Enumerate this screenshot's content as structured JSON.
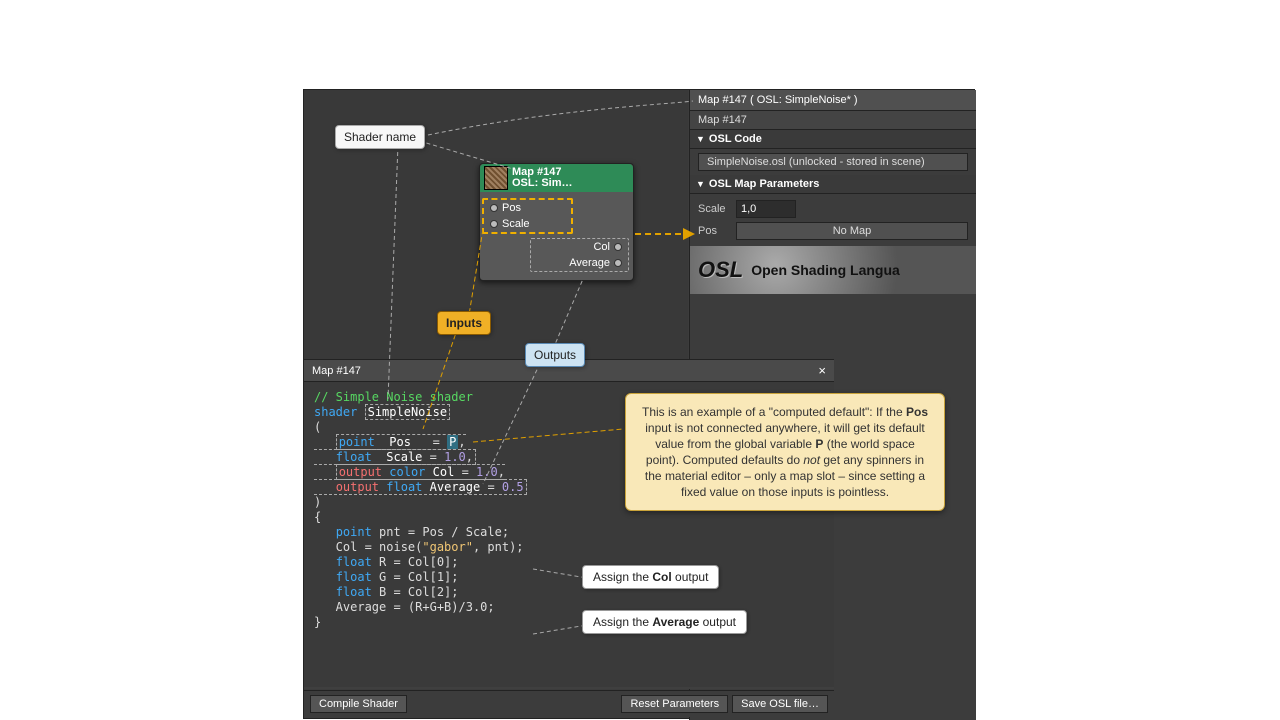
{
  "callouts": {
    "shader_name": "Shader name",
    "inputs": "Inputs",
    "outputs": "Outputs",
    "assign_col_pre": "Assign the ",
    "assign_col_bold": "Col",
    "assign_col_post": " output",
    "assign_avg_pre": "Assign the ",
    "assign_avg_bold": "Average",
    "assign_avg_post": " output"
  },
  "node": {
    "title_line1": "Map #147",
    "title_line2": "OSL: Sim…",
    "inputs": [
      "Pos",
      "Scale"
    ],
    "outputs": [
      "Col",
      "Average"
    ]
  },
  "side": {
    "title": "Map #147 ( OSL: SimpleNoise* )",
    "subtitle": "Map #147",
    "rollout_code_hdr": "OSL Code",
    "osl_file_field": "SimpleNoise.osl (unlocked - stored in scene)",
    "rollout_params_hdr": "OSL Map Parameters",
    "params": {
      "scale_label": "Scale",
      "scale_value": "1,0",
      "pos_label": "Pos",
      "pos_map_btn": "No Map"
    },
    "logo_mark": "OSL",
    "logo_text": "Open Shading Langua"
  },
  "editor": {
    "title": "Map #147",
    "close": "×",
    "comment": "// Simple Noise shader",
    "kw_shader": "shader",
    "shader_name": "SimpleNoise",
    "decl": {
      "t_point": "point",
      "id_pos": "Pos",
      "eq": "=",
      "p_hl": "P",
      "t_float": "float",
      "id_scale": "Scale",
      "val_scale": "1.0",
      "kw_output": "output",
      "t_color": "color",
      "id_col": "Col",
      "val_col": "1.0",
      "id_avg": "Average",
      "val_avg": "0.5"
    },
    "body": {
      "l1": "point pnt = Pos / Scale;",
      "l2a": "Col = noise(",
      "l2s": "\"gabor\"",
      "l2b": ", pnt);",
      "l3": "float R = Col[0];",
      "l4": "float G = Col[1];",
      "l5": "float B = Col[2];",
      "l6": "Average = (R+G+B)/3.0;"
    },
    "btn_compile": "Compile Shader",
    "btn_reset": "Reset Parameters",
    "btn_save": "Save OSL file…"
  },
  "annot": {
    "t1": "This is an example of a \"computed default\": If the ",
    "b1": "Pos",
    "t2": " input is not connected anywhere, it will get its default value from the global variable ",
    "b2": "P",
    "t3": " (the world space point). Computed defaults do ",
    "i1": "not",
    "t4": " get any spinners in the material editor – only a map slot – since setting a fixed value on those inputs is pointless."
  }
}
